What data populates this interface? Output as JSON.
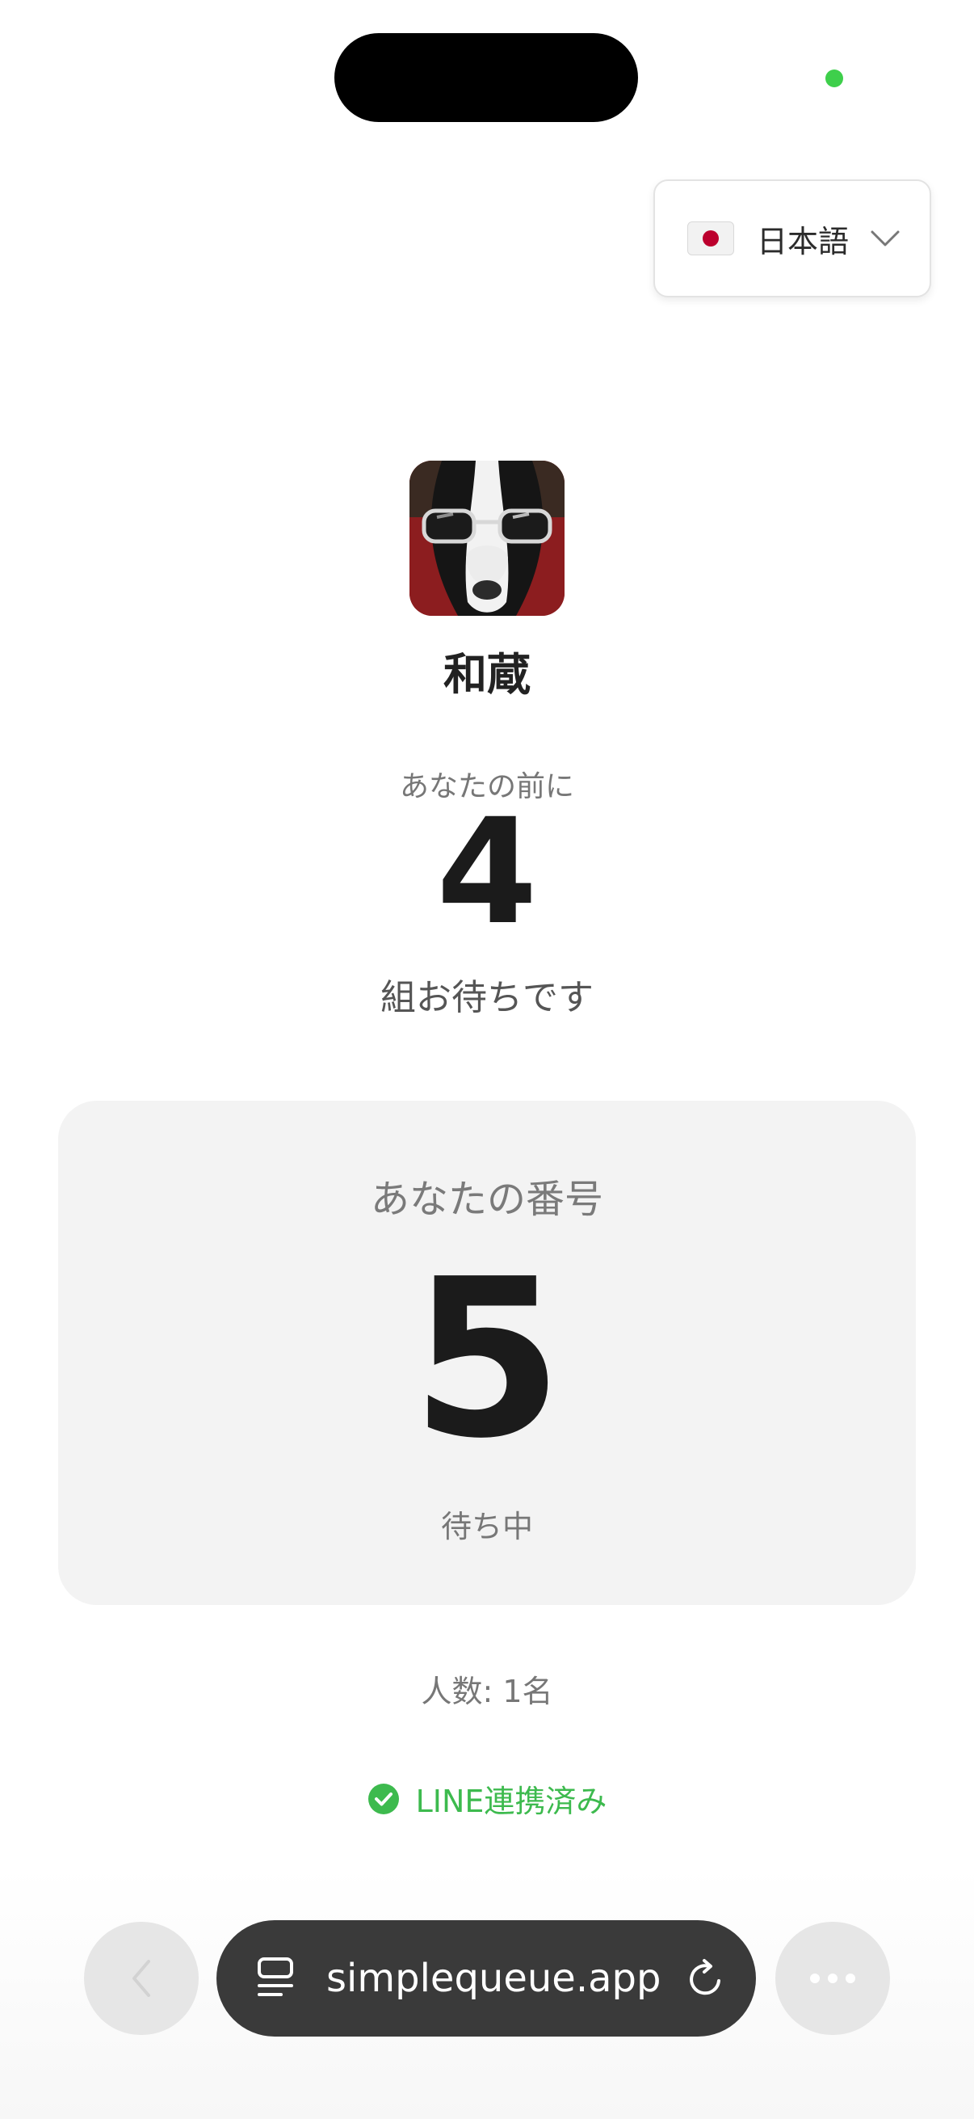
{
  "language_selector": {
    "flag_icon": "japan-flag-icon",
    "label": "日本語",
    "chevron_icon": "chevron-down-icon"
  },
  "shop": {
    "name": "和蔵",
    "avatar": "dog-with-sunglasses-avatar"
  },
  "queue": {
    "ahead_label": "あなたの前に",
    "ahead_count": "4",
    "ahead_suffix": "組お待ちです"
  },
  "ticket": {
    "label": "あなたの番号",
    "number": "5",
    "status": "待ち中"
  },
  "party_size": "人数: 1名",
  "line_status": {
    "icon": "check-circle-icon",
    "label": "LINE連携済み",
    "color": "#3dba4e"
  },
  "browser": {
    "url": "simplequeue.app",
    "back_icon": "chevron-left-icon",
    "tabs_icon": "reader-icon",
    "reload_icon": "reload-icon",
    "more_icon": "more-icon"
  }
}
